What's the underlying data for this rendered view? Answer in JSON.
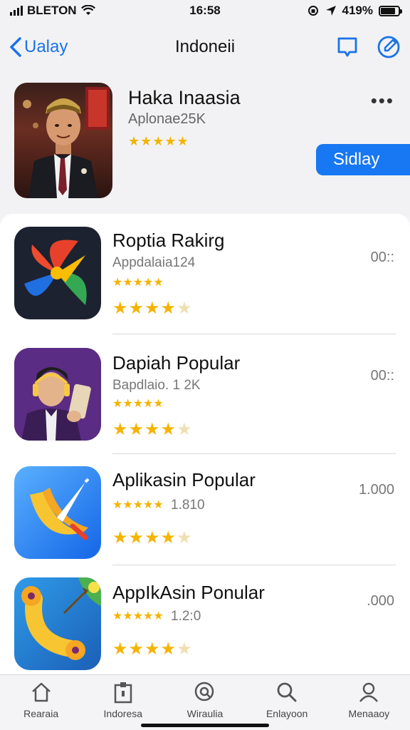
{
  "status": {
    "carrier": "BLETON",
    "time": "16:58",
    "battery": "419%"
  },
  "nav": {
    "back_label": "Ualay",
    "title": "Indoneii"
  },
  "featured": {
    "title": "Haka Inaasia",
    "subtitle": "Aplonae25K",
    "stars": "★★★★★",
    "more": "•••",
    "get_label": "Sidlay"
  },
  "apps": [
    {
      "name": "Roptia Rakirg",
      "sub": "Appdalaia124",
      "stars_small": "★★★★★",
      "stars_big": "★★★★",
      "right": "00::"
    },
    {
      "name": "Dapiah Popular",
      "sub": "Bapdlaio. 1 2K",
      "stars_small": "★★★★★",
      "stars_big": "★★★★",
      "right": "00::"
    },
    {
      "name": "Aplikasin Popular",
      "sub": "1.810",
      "stars_small": "★★★★★",
      "stars_big": "★★★★",
      "right": "1.000"
    },
    {
      "name": "AppIkAsin Ponular",
      "sub": "1.2:0",
      "stars_small": "★★★★★",
      "stars_big": "★★★★",
      "right": ".000"
    }
  ],
  "tabs": [
    {
      "label": "Rearaia",
      "icon": "home-icon"
    },
    {
      "label": "Indoresa",
      "icon": "clipboard-icon"
    },
    {
      "label": "Wiraulia",
      "icon": "search-circle-icon"
    },
    {
      "label": "Enlayoon",
      "icon": "search-icon"
    },
    {
      "label": "Menaaoy",
      "icon": "person-icon"
    }
  ],
  "colors": {
    "accent": "#1877f2",
    "star": "#f4b400"
  }
}
